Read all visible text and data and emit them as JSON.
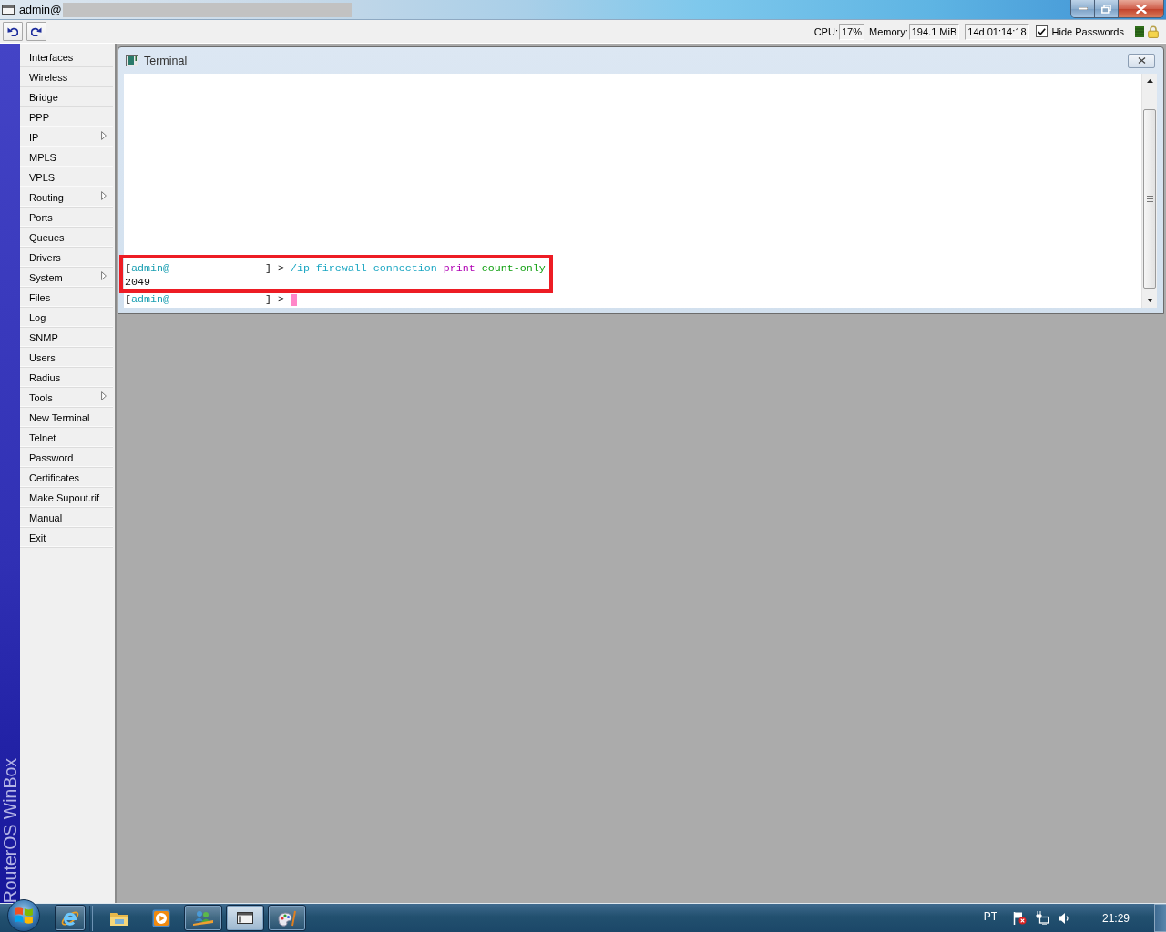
{
  "window": {
    "title": "admin@",
    "redacted": true
  },
  "status": {
    "cpu_label": "CPU:",
    "cpu": "17%",
    "memory_label": "Memory:",
    "memory": "194.1 MiB",
    "uptime": "14d 01:14:18",
    "hide_passwords": {
      "label": "Hide Passwords",
      "checked": true
    }
  },
  "sidebar": {
    "brand": "RouterOS WinBox",
    "items": [
      {
        "label": "Interfaces",
        "submenu": false
      },
      {
        "label": "Wireless",
        "submenu": false
      },
      {
        "label": "Bridge",
        "submenu": false
      },
      {
        "label": "PPP",
        "submenu": false
      },
      {
        "label": "IP",
        "submenu": true
      },
      {
        "label": "MPLS",
        "submenu": false
      },
      {
        "label": "VPLS",
        "submenu": false
      },
      {
        "label": "Routing",
        "submenu": true
      },
      {
        "label": "Ports",
        "submenu": false
      },
      {
        "label": "Queues",
        "submenu": false
      },
      {
        "label": "Drivers",
        "submenu": false
      },
      {
        "label": "System",
        "submenu": true
      },
      {
        "label": "Files",
        "submenu": false
      },
      {
        "label": "Log",
        "submenu": false
      },
      {
        "label": "SNMP",
        "submenu": false
      },
      {
        "label": "Users",
        "submenu": false
      },
      {
        "label": "Radius",
        "submenu": false
      },
      {
        "label": "Tools",
        "submenu": true
      },
      {
        "label": "New Terminal",
        "submenu": false
      },
      {
        "label": "Telnet",
        "submenu": false
      },
      {
        "label": "Password",
        "submenu": false
      },
      {
        "label": "Certificates",
        "submenu": false
      },
      {
        "label": "Make Supout.rif",
        "submenu": false
      },
      {
        "label": "Manual",
        "submenu": false
      },
      {
        "label": "Exit",
        "submenu": false
      }
    ]
  },
  "terminal": {
    "title": "Terminal",
    "lines": [
      {
        "highlighted": true,
        "segments": [
          {
            "kind": "plain",
            "text": "["
          },
          {
            "kind": "host",
            "text": "admin@"
          },
          {
            "kind": "redacted"
          },
          {
            "kind": "plain",
            "text": "] > "
          },
          {
            "kind": "path",
            "text": "/ip firewall connection "
          },
          {
            "kind": "verb",
            "text": "print "
          },
          {
            "kind": "arg",
            "text": "count-only"
          }
        ]
      },
      {
        "highlighted": true,
        "segments": [
          {
            "kind": "plain",
            "text": "2049"
          }
        ]
      },
      {
        "highlighted": false,
        "segments": [
          {
            "kind": "plain",
            "text": "["
          },
          {
            "kind": "host",
            "text": "admin@"
          },
          {
            "kind": "redacted"
          },
          {
            "kind": "plain",
            "text": "] > "
          },
          {
            "kind": "cursor"
          }
        ]
      }
    ]
  },
  "taskbar": {
    "quick_launch": [
      {
        "kind": "browser",
        "running": true,
        "active": false
      }
    ],
    "apps": [
      {
        "kind": "files",
        "running": false,
        "active": false
      },
      {
        "kind": "media",
        "running": false,
        "active": false
      },
      {
        "kind": "network",
        "running": true,
        "active": false
      },
      {
        "kind": "window",
        "running": true,
        "active": true
      },
      {
        "kind": "paint",
        "running": true,
        "active": false
      }
    ],
    "tray": {
      "language": "PT",
      "time": "21:29"
    }
  }
}
